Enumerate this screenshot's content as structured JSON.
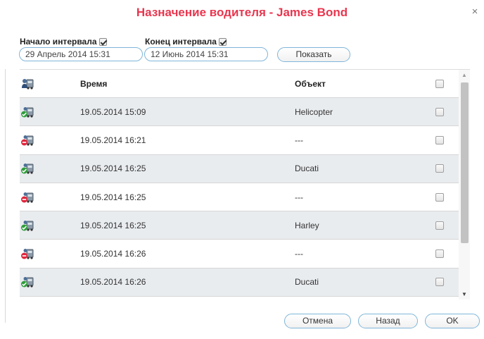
{
  "dialog": {
    "title": "Назначение водителя - James Bond",
    "close_glyph": "×"
  },
  "filter": {
    "start_label": "Начало интервала",
    "start_checked": true,
    "start_value": "29 Апрель 2014 15:31",
    "end_label": "Конец интервала",
    "end_checked": true,
    "end_value": "12 Июнь 2014 15:31",
    "show_button": "Показать"
  },
  "table": {
    "header_icon": "driver-vehicle-icon",
    "col_time": "Время",
    "col_object": "Объект",
    "rows": [
      {
        "status": "assigned",
        "time": "19.05.2014 15:09",
        "object": "Helicopter"
      },
      {
        "status": "unassigned",
        "time": "19.05.2014 16:21",
        "object": "---"
      },
      {
        "status": "assigned",
        "time": "19.05.2014 16:25",
        "object": "Ducati"
      },
      {
        "status": "unassigned",
        "time": "19.05.2014 16:25",
        "object": "---"
      },
      {
        "status": "assigned",
        "time": "19.05.2014 16:25",
        "object": "Harley"
      },
      {
        "status": "unassigned",
        "time": "19.05.2014 16:26",
        "object": "---"
      },
      {
        "status": "assigned",
        "time": "19.05.2014 16:26",
        "object": "Ducati"
      }
    ]
  },
  "footer": {
    "cancel": "Отмена",
    "back": "Назад",
    "ok": "OK"
  },
  "colors": {
    "title": "#e8364f",
    "assigned": "#2e9e3a",
    "unassigned": "#e0263c",
    "border": "#7fb6d9"
  }
}
